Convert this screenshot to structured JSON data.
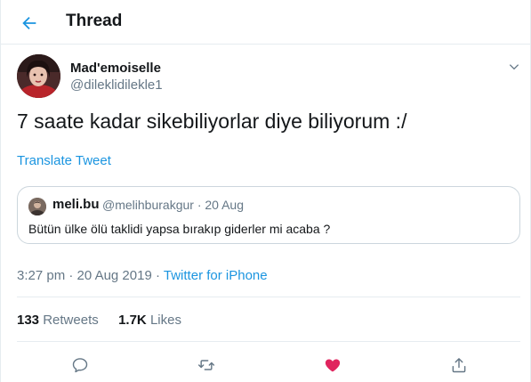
{
  "header": {
    "title": "Thread",
    "back_icon": "arrow-left-icon"
  },
  "tweet": {
    "author_name": "Mad'emoiselle",
    "author_handle": "@dileklidilekle1",
    "text": "7 saate kadar sikebiliyorlar diye biliyorum :/",
    "translate_label": "Translate Tweet",
    "time": "3:27 pm",
    "date": "20 Aug 2019",
    "source": "Twitter for iPhone",
    "separator": "·"
  },
  "quoted": {
    "name": "meli.bu",
    "handle": "@melihburakgur",
    "date": "20 Aug",
    "separator": "·",
    "text": "Bütün ülke ölü taklidi yapsa bırakıp giderler mi acaba ?"
  },
  "stats": {
    "retweets_count": "133",
    "retweets_label": "Retweets",
    "likes_count": "1.7K",
    "likes_label": "Likes"
  },
  "actions": {
    "reply_icon": "reply-icon",
    "retweet_icon": "retweet-icon",
    "like_icon": "heart-icon",
    "share_icon": "share-icon"
  },
  "colors": {
    "accent": "#1b95e0",
    "like": "#e0245e",
    "secondary_text": "#657786",
    "border": "#e6ecf0"
  }
}
